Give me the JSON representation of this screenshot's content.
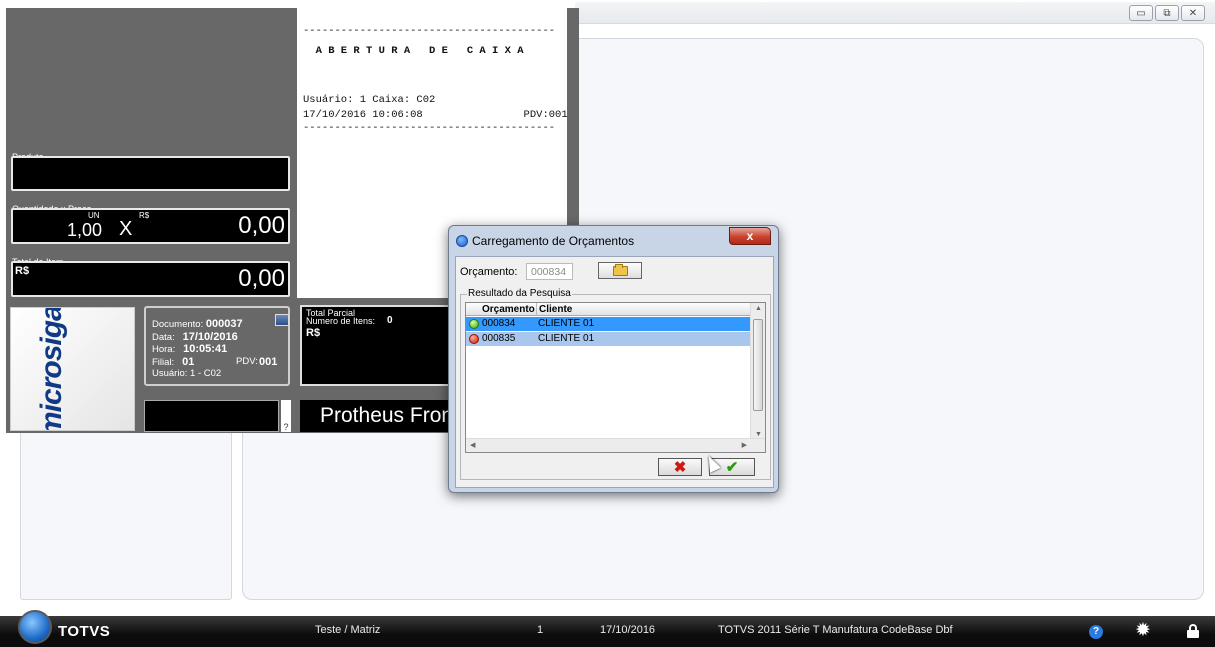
{
  "window": {
    "minimize": "▭",
    "restore": "⧉",
    "close": "✕"
  },
  "receipt": {
    "lines": [
      "----------------------------------------",
      "  A B E R T U R A   D E   C A I X A",
      "Usuário: 1 Caixa: C02",
      "17/10/2016 10:06:08                PDV:001",
      "----------------------------------------"
    ]
  },
  "pos": {
    "produto_label": "Produto",
    "qtd_preco_label": "Quantidade x Preco",
    "un_label": "UN",
    "rs_small": "R$",
    "qty_value": "1,00",
    "x_sign": "X",
    "price_value": "0,00",
    "total_item_label": "Total do Item",
    "total_item_currency": "R$",
    "total_item_value": "0,00",
    "logo_text": "microsiga",
    "doc": {
      "documento_label": "Documento:",
      "documento_value": "000037",
      "data_label": "Data:",
      "data_value": "17/10/2016",
      "hora_label": "Hora:",
      "hora_value": "10:05:41",
      "filial_label": "Filial:",
      "filial_value": "01",
      "pdv_label": "PDV:",
      "pdv_value": "001",
      "usuario_label": "Usuário:",
      "usuario_value": "1 - C02"
    },
    "help_q": "?",
    "total_parcial_label": "Total Parcial",
    "num_itens_label": "Numero de Itens:",
    "num_itens_value": "0",
    "total_parcial_currency": "R$",
    "banner": "Protheus Front Loja"
  },
  "dialog": {
    "title": "Carregamento de Orçamentos",
    "close_label": "x",
    "orcamento_label": "Orçamento:",
    "orcamento_value": "000834",
    "group_title": "Resultado da Pesquisa",
    "columns": [
      "Orçamento",
      "Cliente"
    ],
    "rows": [
      {
        "status": "green",
        "orcamento": "000834",
        "cliente": "CLIENTE 01"
      },
      {
        "status": "red",
        "orcamento": "000835",
        "cliente": "CLIENTE 01"
      }
    ],
    "cancel_glyph": "✖",
    "ok_glyph": "✔"
  },
  "taskbar": {
    "brand": "TOTVS",
    "company": "Teste / Matriz",
    "number": "1",
    "date": "17/10/2016",
    "product": "TOTVS 2011 Série T Manufatura CodeBase Dbf",
    "help_glyph": "?"
  }
}
